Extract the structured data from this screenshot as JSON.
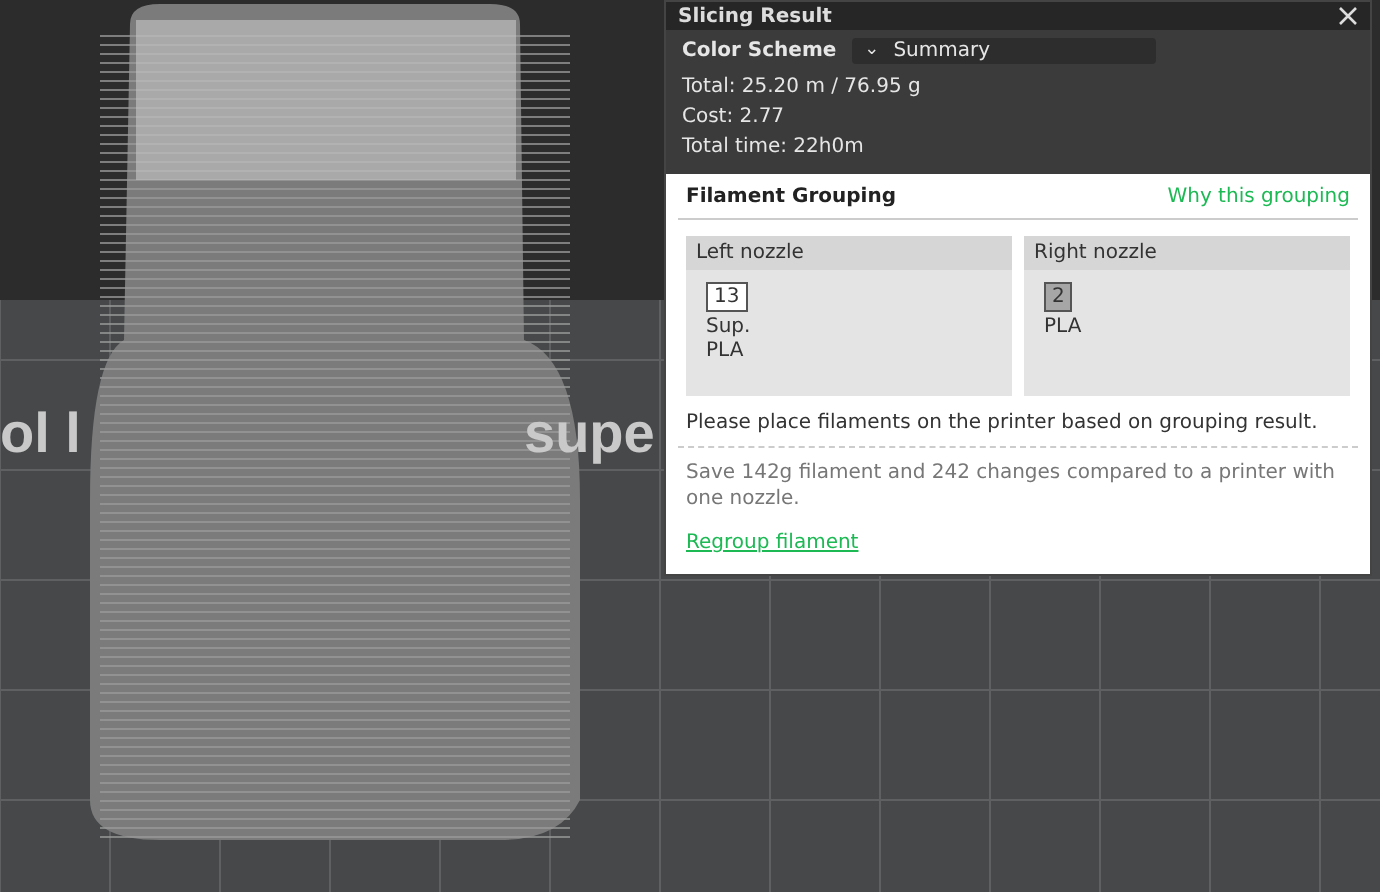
{
  "viewport": {
    "bed_texts": [
      "ol l",
      "supe"
    ]
  },
  "panel": {
    "title": "Slicing Result",
    "color_scheme": {
      "label": "Color Scheme",
      "value": "Summary",
      "caret": "⌄"
    },
    "stats": [
      "Total:  25.20 m / 76.95 g",
      "Cost:  2.77",
      "Total time:  22h0m"
    ],
    "grouping": {
      "title": "Filament Grouping",
      "link": "Why this grouping",
      "nozzles": [
        {
          "name": "Left nozzle",
          "filaments": [
            {
              "number": "13",
              "color": "#ffffff",
              "label": "Sup.\nPLA"
            }
          ]
        },
        {
          "name": "Right nozzle",
          "filaments": [
            {
              "number": "2",
              "color": "#a6a6a6",
              "label": "PLA"
            }
          ]
        }
      ],
      "instruction": "Please place filaments on the printer based on grouping result.",
      "savings": "Save 142g filament and 242 changes compared to a printer with one nozzle.",
      "regroup": "Regroup filament"
    }
  }
}
